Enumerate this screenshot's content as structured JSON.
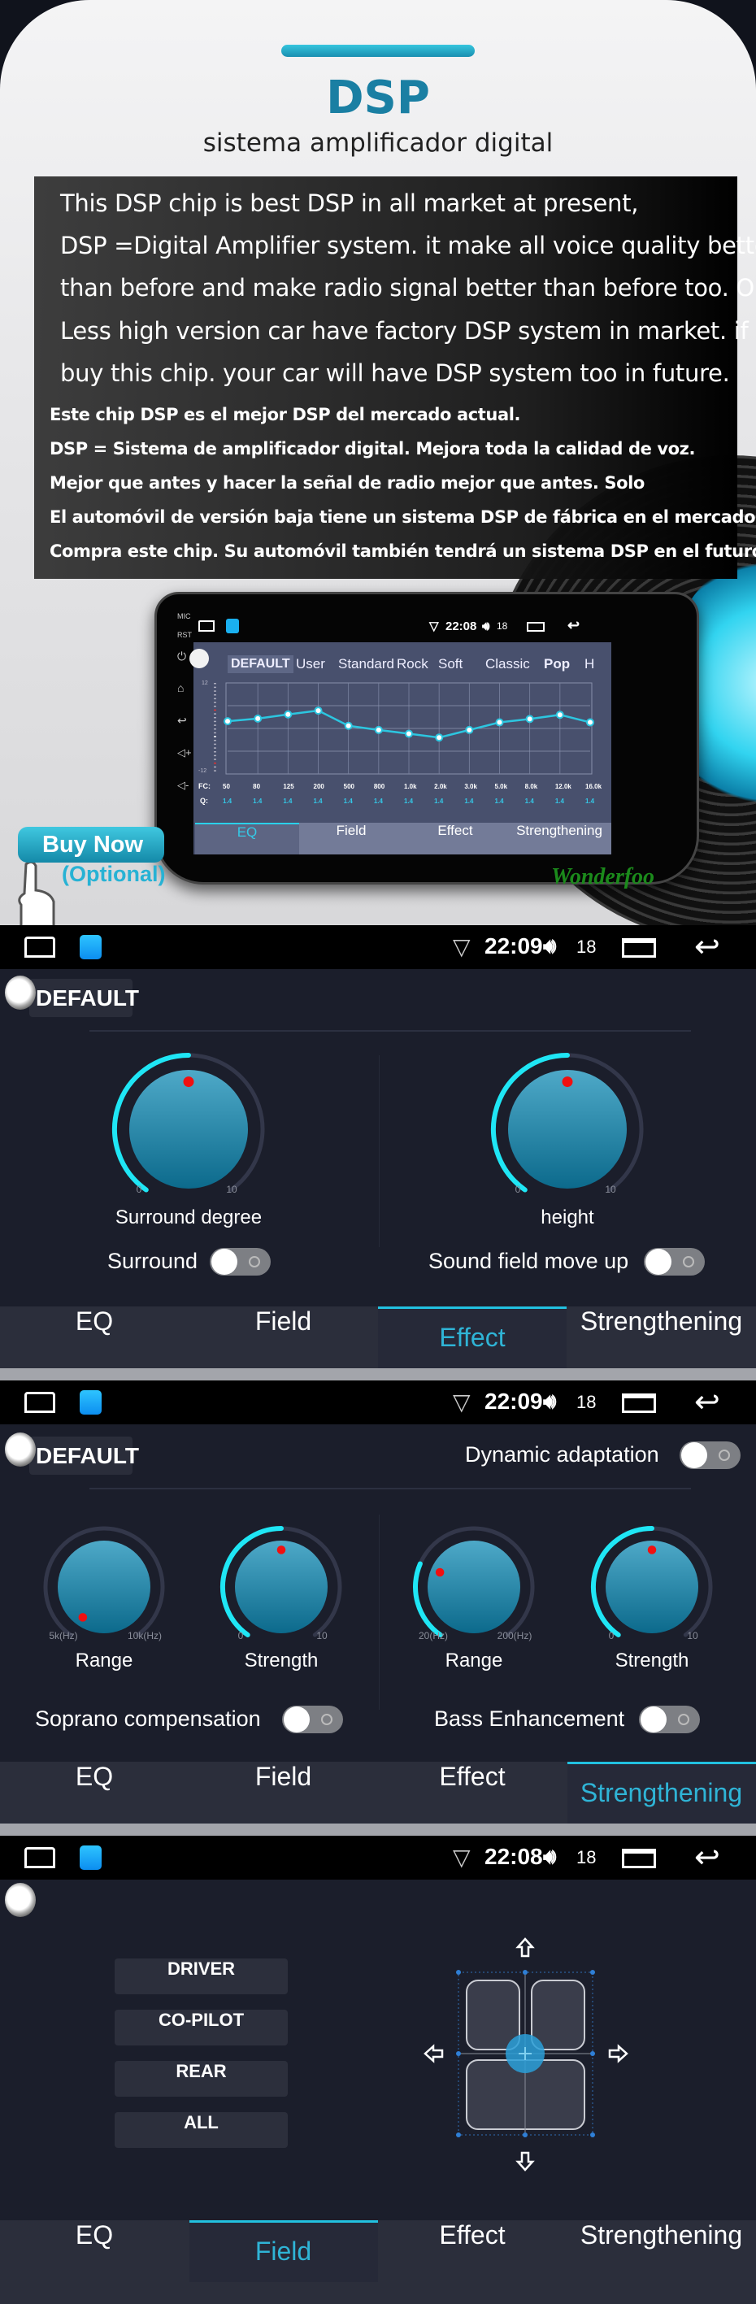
{
  "banner": {
    "title": "DSP",
    "subtitle": "sistema amplificador digital",
    "english_lines": [
      "This DSP chip is best DSP in all market at present,",
      "DSP =Digital Amplifier system. it make all voice quality better",
      "than before and make radio signal better than before too. Only",
      "Less high version car have factory DSP system in market. if you",
      "buy this chip. your car will have DSP system too in future."
    ],
    "spanish_lines": [
      "Este chip DSP es el mejor DSP del mercado actual.",
      "DSP = Sistema de amplificador digital. Mejora toda la calidad de voz.",
      "Mejor que antes y hacer la señal de radio mejor que antes. Solo",
      "El automóvil de versión baja tiene un sistema DSP de fábrica en el mercado. Si tu",
      "Compra este chip. Su automóvil también tendrá un sistema DSP en el futuro."
    ],
    "buy_now": "Buy Now",
    "optional": "(Optional)",
    "logo_text": "Wonderfoo",
    "colors": {
      "title": "#1a7fa3",
      "accent": "#22c1e0"
    }
  },
  "head_unit": {
    "side_labels": [
      "MIC",
      "RST"
    ],
    "side_icons": [
      "power-icon",
      "home-icon",
      "back-icon",
      "volume-up-icon",
      "volume-down-icon"
    ],
    "status": {
      "time": "22:08",
      "volume": "18"
    },
    "presets": [
      "DEFAULT",
      "User",
      "Standard",
      "Rock",
      "Soft",
      "Classic",
      "Pop",
      "H"
    ],
    "selected_preset": "DEFAULT",
    "eq": {
      "y_range": [
        -12,
        12
      ],
      "y_max_label": "12",
      "y_min_label": "-12",
      "fc_label": "FC:",
      "q_label": "Q:",
      "fc": [
        "50",
        "80",
        "125",
        "200",
        "500",
        "800",
        "1.0k",
        "2.0k",
        "3.0k",
        "5.0k",
        "8.0k",
        "12.0k",
        "16.0k"
      ],
      "q": [
        "1.4",
        "1.4",
        "1.4",
        "1.4",
        "1.4",
        "1.4",
        "1.4",
        "1.4",
        "1.4",
        "1.4",
        "1.4",
        "1.4",
        "1.4"
      ],
      "gain_db": [
        1.9,
        2.6,
        3.7,
        4.7,
        0.7,
        -0.4,
        -1.4,
        -2.4,
        -0.4,
        1.6,
        2.5,
        3.6,
        1.6
      ]
    },
    "tabs": [
      "EQ",
      "Field",
      "Effect",
      "Strengthening"
    ],
    "active_tab": 0
  },
  "tabs": [
    "EQ",
    "Field",
    "Effect",
    "Strengthening"
  ],
  "effect_screen": {
    "status": {
      "time": "22:09",
      "volume": "18"
    },
    "preset": "DEFAULT",
    "knobs": [
      {
        "label": "Surround degree",
        "min": "0",
        "max": "10",
        "value_fraction": 0.5
      },
      {
        "label": "height",
        "min": "0",
        "max": "10",
        "value_fraction": 0.5
      }
    ],
    "toggles": [
      {
        "label": "Surround",
        "on": false
      },
      {
        "label": "Sound field move up",
        "on": false
      }
    ],
    "active_tab": 2
  },
  "strengthening_screen": {
    "status": {
      "time": "22:09",
      "volume": "18"
    },
    "preset": "DEFAULT",
    "dynamic_adaptation": {
      "label": "Dynamic adaptation",
      "on": false
    },
    "knobs": [
      {
        "label": "Range",
        "min": "5k(Hz)",
        "max": "10k(Hz)",
        "value_fraction": 0.0
      },
      {
        "label": "Strength",
        "min": "0",
        "max": "10",
        "value_fraction": 0.5
      },
      {
        "label": "Range",
        "min": "20(Hz)",
        "max": "200(Hz)",
        "value_fraction": 0.27
      },
      {
        "label": "Strength",
        "min": "0",
        "max": "10",
        "value_fraction": 0.5
      }
    ],
    "toggles": [
      {
        "label": "Soprano compensation",
        "on": false
      },
      {
        "label": "Bass Enhancement",
        "on": false
      }
    ],
    "active_tab": 3
  },
  "field_screen": {
    "status": {
      "time": "22:08",
      "volume": "18"
    },
    "position_buttons": [
      "DRIVER",
      "CO-PILOT",
      "REAR",
      "ALL"
    ],
    "arrows": [
      "arrow-up-icon",
      "arrow-down-icon",
      "arrow-left-icon",
      "arrow-right-icon"
    ],
    "active_tab": 1
  }
}
